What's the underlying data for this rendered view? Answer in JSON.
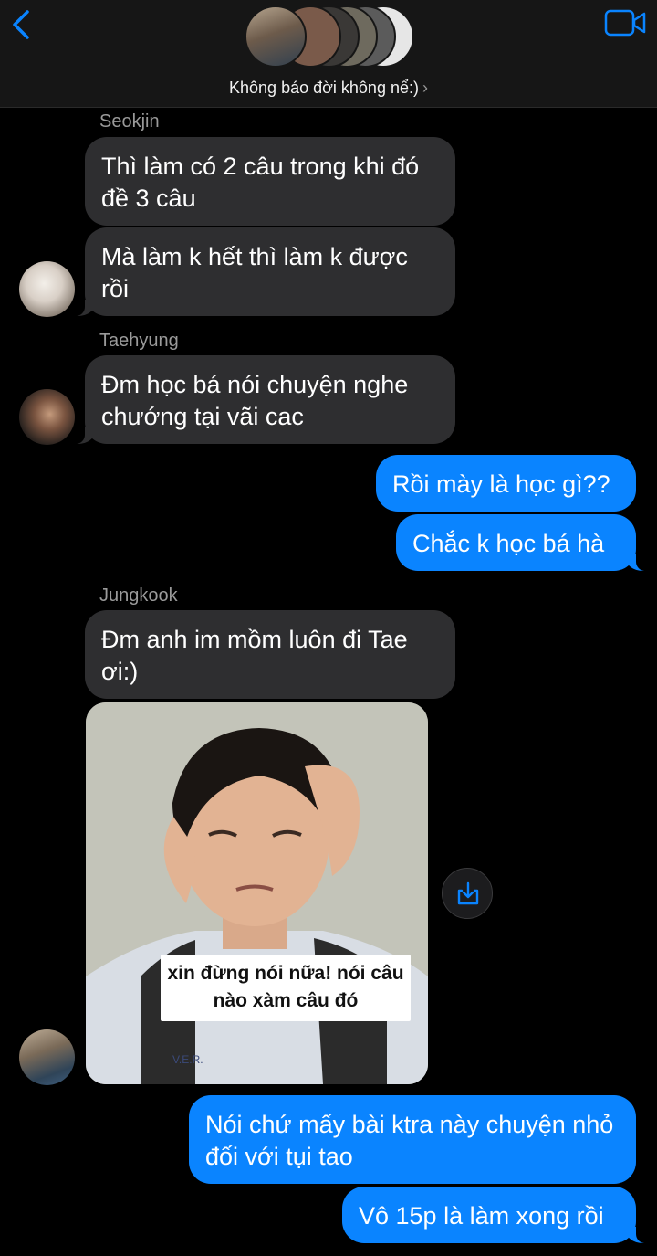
{
  "header": {
    "group_name": "Không báo đời không nể:)",
    "chevron": "›",
    "back_icon": "chevron-left-icon",
    "video_icon": "video-call-icon",
    "accent": "#0a84ff"
  },
  "messages": [
    {
      "sender": "Seokjin",
      "text": "Thì làm có 2 câu trong khi đó đề 3 câu"
    },
    {
      "text": "Mà làm k hết thì làm k được rồi"
    },
    {
      "sender": "Taehyung",
      "text": "Đm học bá nói chuyện nghe chướng tại vãi cac"
    },
    {
      "text": "Rồi mày là học gì??"
    },
    {
      "text": "Chắc k học bá hà"
    },
    {
      "sender": "Jungkook",
      "text": "Đm anh im mồm luôn đi Tae ơi:)"
    },
    {
      "image_caption": "xin đừng nói nữa! nói câu nào xàm câu đó"
    },
    {
      "text": "Nói chứ mấy bài ktra này chuyện nhỏ đối với tụi tao"
    },
    {
      "text": "Vô 15p là làm xong rồi"
    }
  ],
  "colors": {
    "incoming_bubble": "#2e2e30",
    "outgoing_bubble": "#0a84ff",
    "background": "#000000"
  }
}
